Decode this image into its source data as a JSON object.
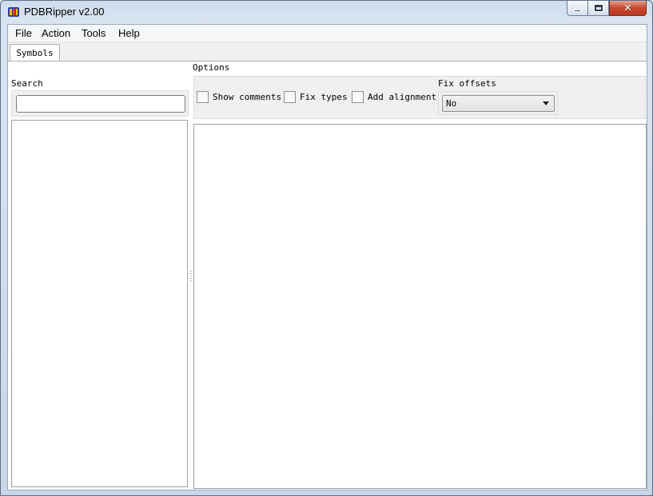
{
  "window": {
    "title": "PDBRipper v2.00",
    "icon": "pdbripper-app-icon",
    "controls": {
      "minimize": "minimize-icon",
      "maximize": "maximize-icon",
      "close": "close-icon",
      "close_glyph": "✕"
    }
  },
  "menu": {
    "items": [
      {
        "label": "File"
      },
      {
        "label": "Action"
      },
      {
        "label": "Tools"
      },
      {
        "label": "Help"
      }
    ]
  },
  "tabs": [
    {
      "label": "Symbols",
      "selected": true
    }
  ],
  "search": {
    "label": "Search",
    "value": "",
    "placeholder": ""
  },
  "options": {
    "label": "Options",
    "checkboxes": [
      {
        "label": "Show comments",
        "checked": false
      },
      {
        "label": "Fix types",
        "checked": false
      },
      {
        "label": "Add alignment",
        "checked": false
      }
    ],
    "fix_offsets": {
      "label": "Fix offsets",
      "selected": "No"
    }
  },
  "colors": {
    "close_button": "#c9462c",
    "titlebar": "#dbe5f1"
  }
}
